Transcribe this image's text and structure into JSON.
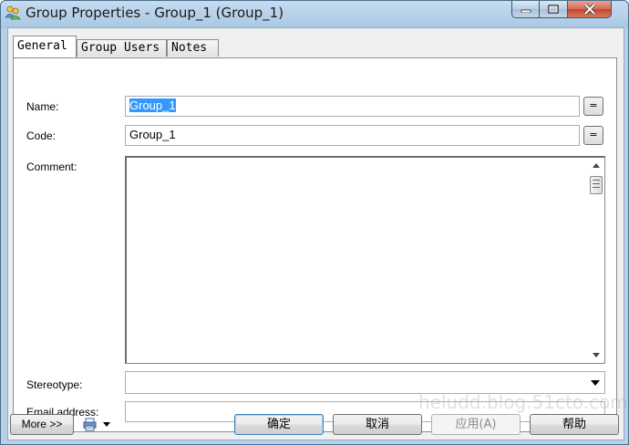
{
  "window": {
    "title": "Group Properties - Group_1 (Group_1)"
  },
  "tabs": [
    {
      "label": "General",
      "active": true
    },
    {
      "label": "Group Users",
      "active": false
    },
    {
      "label": "Notes",
      "active": false
    }
  ],
  "form": {
    "name_label": "Name:",
    "name_value": "Group_1",
    "code_label": "Code:",
    "code_value": "Group_1",
    "equals_label": "=",
    "comment_label": "Comment:",
    "comment_value": "",
    "stereotype_label": "Stereotype:",
    "stereotype_value": "",
    "email_label": "Email address:",
    "email_value": ""
  },
  "buttons": {
    "more": "More >>",
    "ok": "确定",
    "cancel": "取消",
    "apply": "应用(A)",
    "help": "帮助"
  },
  "watermark": "heludd.blog.51cto.com",
  "colors": {
    "selection": "#3399ff",
    "ok_border": "#3c7fb1",
    "close_red": "#c3472c"
  }
}
